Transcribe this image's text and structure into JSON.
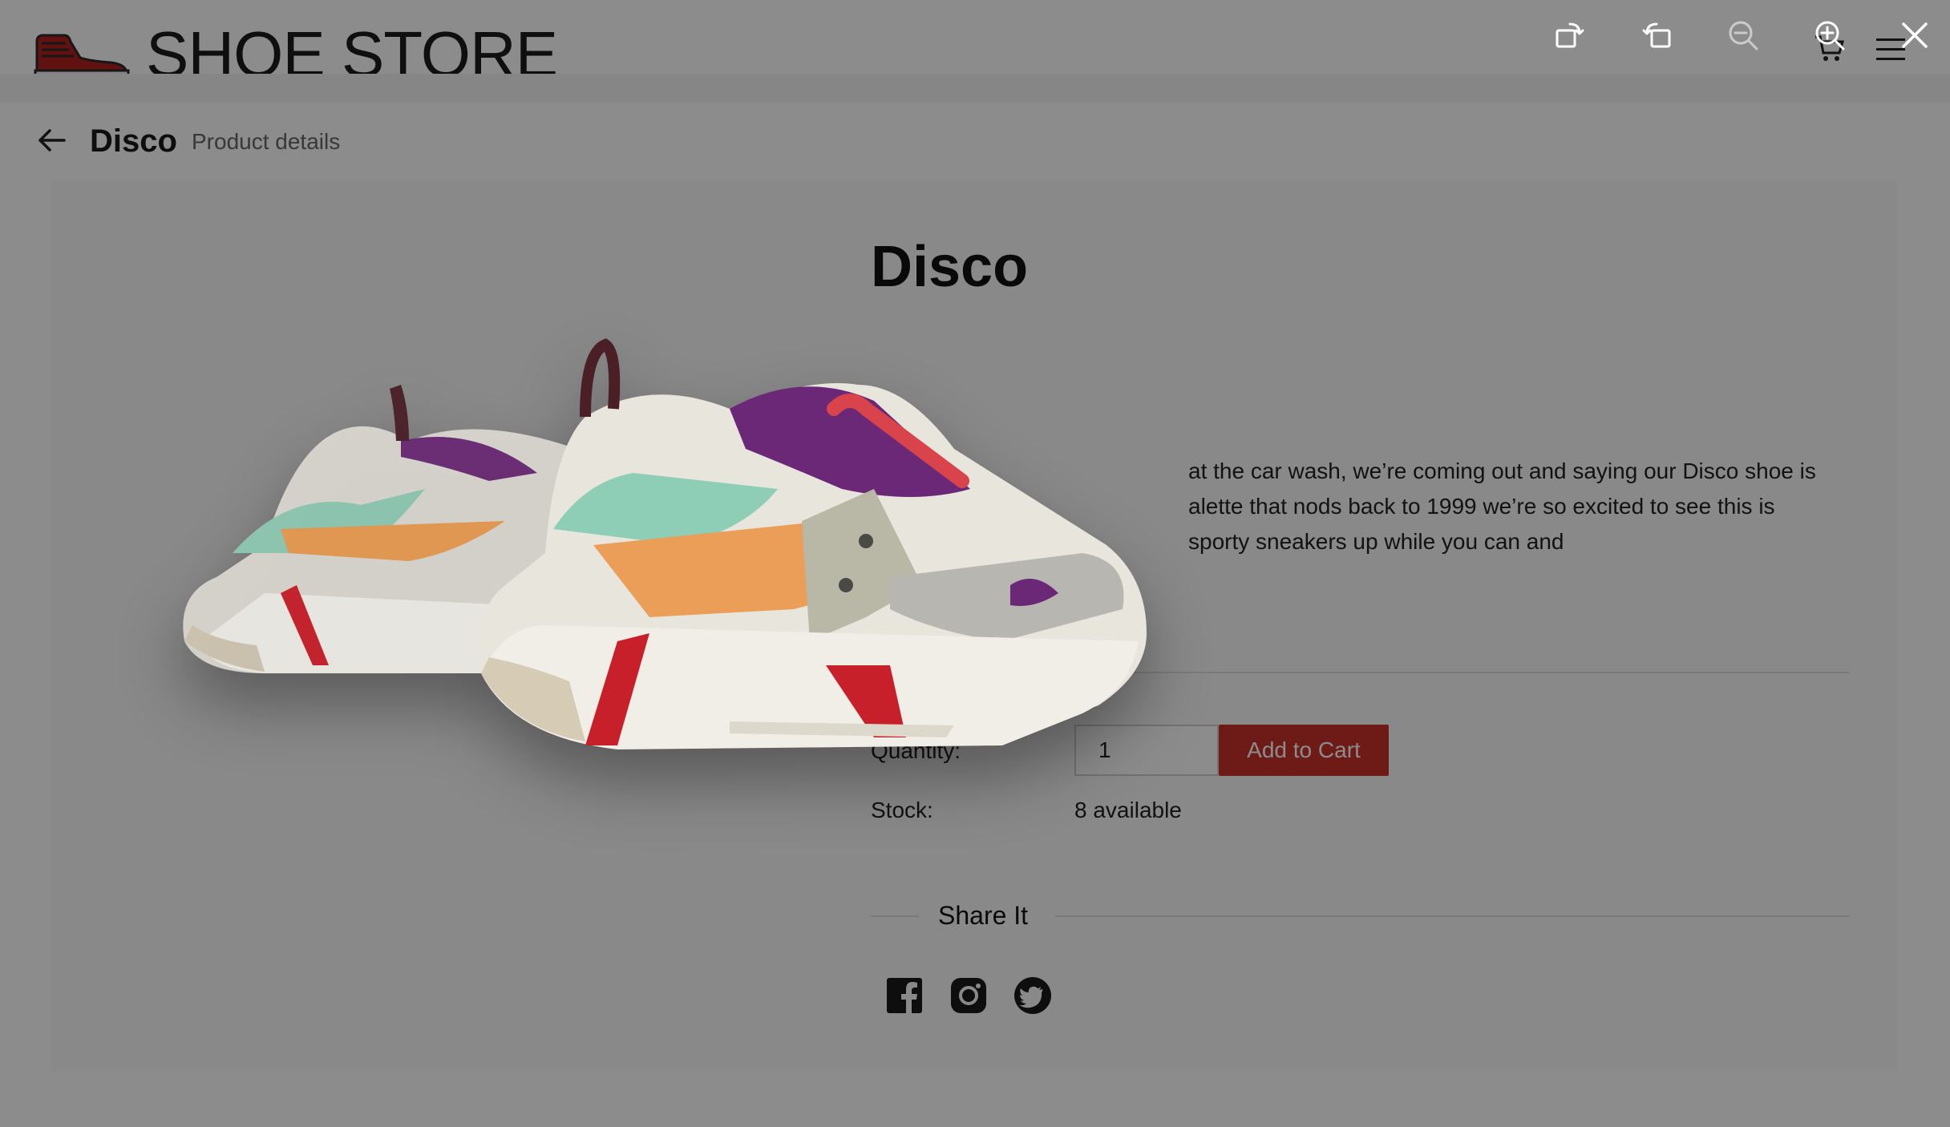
{
  "header": {
    "store_name": "SHOE STORE"
  },
  "breadcrumb": {
    "title": "Disco",
    "subtitle": "Product details"
  },
  "product": {
    "name": "Disco",
    "description_visible": "at the car wash, we’re coming out and saying our Disco shoe is\nalette that nods back to 1999 we’re so excited to see this is\nsporty sneakers up while you can and",
    "quantity_label": "Quantity:",
    "quantity_value": "1",
    "add_to_cart_label": "Add to Cart",
    "stock_label": "Stock:",
    "stock_value": "8 available",
    "share_heading": "Share It"
  },
  "social": {
    "icons": [
      "facebook-icon",
      "instagram-icon",
      "twitter-icon"
    ]
  },
  "lightbox": {
    "toolbar": [
      "rotate-left-icon",
      "rotate-right-icon",
      "zoom-out-icon",
      "zoom-in-icon",
      "close-icon"
    ]
  },
  "colors": {
    "accent_red": "#c8322c",
    "overlay": "rgba(0,0,0,0.45)"
  }
}
